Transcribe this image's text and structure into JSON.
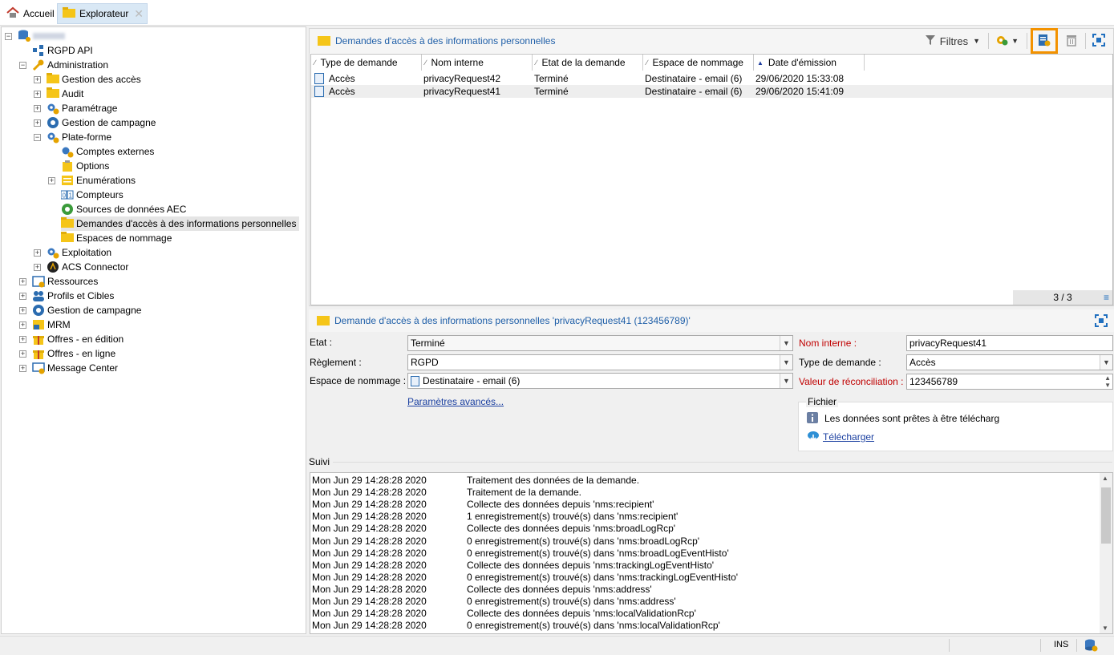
{
  "tabs": [
    {
      "label": "Accueil",
      "icon": "home-icon"
    },
    {
      "label": "Explorateur",
      "icon": "folder-icon"
    }
  ],
  "tree": [
    {
      "label": "",
      "depth": 0,
      "exp": "-",
      "icon": "database-icon",
      "blurred": true
    },
    {
      "label": "RGPD API",
      "depth": 1,
      "exp": "",
      "icon": "api-icon"
    },
    {
      "label": "Administration",
      "depth": 1,
      "exp": "-",
      "icon": "wrench-icon"
    },
    {
      "label": "Gestion des accès",
      "depth": 2,
      "exp": "+",
      "icon": "folder-icon"
    },
    {
      "label": "Audit",
      "depth": 2,
      "exp": "+",
      "icon": "folder-icon"
    },
    {
      "label": "Paramétrage",
      "depth": 2,
      "exp": "+",
      "icon": "gears-icon"
    },
    {
      "label": "Gestion de campagne",
      "depth": 2,
      "exp": "+",
      "icon": "campaign-icon"
    },
    {
      "label": "Plate-forme",
      "depth": 2,
      "exp": "-",
      "icon": "gears-icon"
    },
    {
      "label": "Comptes externes",
      "depth": 3,
      "exp": "",
      "icon": "gear-account-icon"
    },
    {
      "label": "Options",
      "depth": 3,
      "exp": "",
      "icon": "options-icon"
    },
    {
      "label": "Enumérations",
      "depth": 3,
      "exp": "+",
      "icon": "list-icon"
    },
    {
      "label": "Compteurs",
      "depth": 3,
      "exp": "",
      "icon": "counter-icon"
    },
    {
      "label": "Sources de données AEC",
      "depth": 3,
      "exp": "",
      "icon": "datasource-icon"
    },
    {
      "label": "Demandes d'accès à des informations personnelles",
      "depth": 3,
      "exp": "",
      "icon": "folder-icon",
      "selected": true
    },
    {
      "label": "Espaces de nommage",
      "depth": 3,
      "exp": "",
      "icon": "folder-icon"
    },
    {
      "label": "Exploitation",
      "depth": 2,
      "exp": "+",
      "icon": "gears-icon"
    },
    {
      "label": "ACS Connector",
      "depth": 2,
      "exp": "+",
      "icon": "connector-icon"
    },
    {
      "label": "Ressources",
      "depth": 1,
      "exp": "+",
      "icon": "resources-icon"
    },
    {
      "label": "Profils et Cibles",
      "depth": 1,
      "exp": "+",
      "icon": "people-icon"
    },
    {
      "label": "Gestion de campagne",
      "depth": 1,
      "exp": "+",
      "icon": "campaign-icon"
    },
    {
      "label": "MRM",
      "depth": 1,
      "exp": "+",
      "icon": "mrm-icon"
    },
    {
      "label": "Offres - en édition",
      "depth": 1,
      "exp": "+",
      "icon": "gift-icon"
    },
    {
      "label": "Offres - en ligne",
      "depth": 1,
      "exp": "+",
      "icon": "gift-icon"
    },
    {
      "label": "Message Center",
      "depth": 1,
      "exp": "+",
      "icon": "message-center-icon"
    }
  ],
  "top_pane": {
    "title": "Demandes d'accès à des informations personnelles",
    "filters_label": "Filtres",
    "columns": [
      "Type de demande",
      "Nom interne",
      "Etat de la demande",
      "Espace de nommage",
      "Date d'émission"
    ],
    "rows": [
      [
        "Accès",
        "privacyRequest42",
        "Terminé",
        "Destinataire - email (6)",
        "29/06/2020 15:33:08"
      ],
      [
        "Accès",
        "privacyRequest41",
        "Terminé",
        "Destinataire - email (6)",
        "29/06/2020 15:41:09"
      ]
    ],
    "count": "3 / 3"
  },
  "detail": {
    "title": "Demande d'accès à des informations personnelles 'privacyRequest41 (123456789)'",
    "etat_label": "Etat :",
    "etat_value": "Terminé",
    "reglement_label": "Règlement :",
    "reglement_value": "RGPD",
    "espace_label": "Espace de nommage :",
    "espace_value": "Destinataire - email (6)",
    "nom_interne_label": "Nom interne :",
    "nom_interne_value": "privacyRequest41",
    "type_label": "Type de demande :",
    "type_value": "Accès",
    "reconciliation_label": "Valeur de réconciliation :",
    "reconciliation_value": "123456789",
    "advanced_link": "Paramètres avancés...",
    "fichier_legend": "Fichier",
    "fichier_info": "Les données sont prêtes à être télécharg",
    "download_link": "Télécharger",
    "suivi_label": "Suivi"
  },
  "log": [
    [
      "Mon Jun 29 14:28:28 2020",
      "Traitement des données de la demande."
    ],
    [
      "Mon Jun 29 14:28:28 2020",
      "Traitement de la demande."
    ],
    [
      "Mon Jun 29 14:28:28 2020",
      "Collecte des données depuis 'nms:recipient'"
    ],
    [
      "Mon Jun 29 14:28:28 2020",
      "1 enregistrement(s) trouvé(s) dans 'nms:recipient'"
    ],
    [
      "Mon Jun 29 14:28:28 2020",
      "Collecte des données depuis 'nms:broadLogRcp'"
    ],
    [
      "Mon Jun 29 14:28:28 2020",
      "0 enregistrement(s) trouvé(s) dans 'nms:broadLogRcp'"
    ],
    [
      "Mon Jun 29 14:28:28 2020",
      "0 enregistrement(s) trouvé(s) dans 'nms:broadLogEventHisto'"
    ],
    [
      "Mon Jun 29 14:28:28 2020",
      "Collecte des données depuis 'nms:trackingLogEventHisto'"
    ],
    [
      "Mon Jun 29 14:28:28 2020",
      "0 enregistrement(s) trouvé(s) dans  'nms:trackingLogEventHisto'"
    ],
    [
      "Mon Jun 29 14:28:28 2020",
      "Collecte des données depuis 'nms:address'"
    ],
    [
      "Mon Jun 29 14:28:28 2020",
      "0 enregistrement(s) trouvé(s) dans 'nms:address'"
    ],
    [
      "Mon Jun 29 14:28:28 2020",
      "Collecte des données depuis 'nms:localValidationRcp'"
    ],
    [
      "Mon Jun 29 14:28:28 2020",
      "0 enregistrement(s) trouvé(s) dans 'nms:localValidationRcp'"
    ]
  ],
  "status": {
    "ins": "INS"
  },
  "colors": {
    "accent": "#1f5fa8",
    "highlight": "#f39200",
    "folder": "#f5c518",
    "required": "#c00000"
  }
}
